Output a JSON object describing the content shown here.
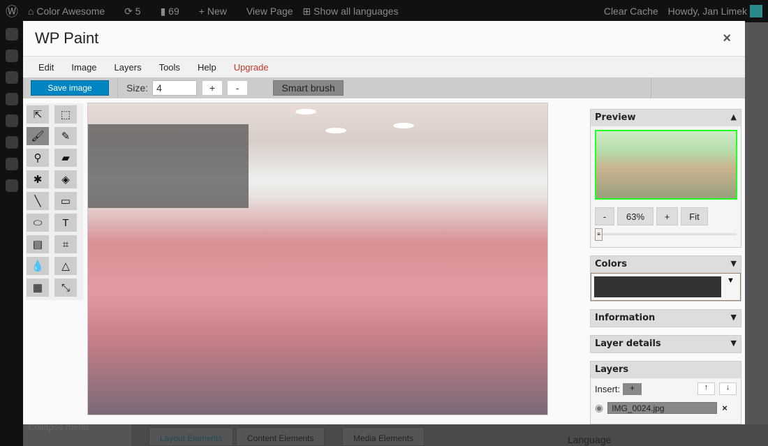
{
  "adminbar": {
    "site": "Color Awesome",
    "updates": "5",
    "comments": "69",
    "new": "New",
    "view_page": "View Page",
    "languages": "Show all languages",
    "clear_cache": "Clear Cache",
    "howdy": "Howdy, Jan Limek"
  },
  "background": {
    "collapse_menu": "Collapse menu",
    "tabs": [
      "Layout Elements",
      "Content Elements",
      "Media Elements"
    ],
    "language": "Language"
  },
  "modal": {
    "title": "WP Paint",
    "close": "×"
  },
  "menu": [
    "Edit",
    "Image",
    "Layers",
    "Tools",
    "Help",
    "Upgrade"
  ],
  "toolbar": {
    "save": "Save image",
    "size_label": "Size:",
    "size_value": "4",
    "plus": "+",
    "minus": "-",
    "smart_brush": "Smart brush"
  },
  "tools": [
    {
      "name": "select",
      "glyph": "⇱"
    },
    {
      "name": "select-rect",
      "glyph": "⬚"
    },
    {
      "name": "brush",
      "glyph": "🖌"
    },
    {
      "name": "pencil",
      "glyph": "✎"
    },
    {
      "name": "pick-color",
      "glyph": "⚲"
    },
    {
      "name": "erase",
      "glyph": "▰"
    },
    {
      "name": "magic-wand",
      "glyph": "✱"
    },
    {
      "name": "fill",
      "glyph": "◈"
    },
    {
      "name": "line",
      "glyph": "╲"
    },
    {
      "name": "rectangle",
      "glyph": "▭"
    },
    {
      "name": "ellipse",
      "glyph": "⬭"
    },
    {
      "name": "text",
      "glyph": "T"
    },
    {
      "name": "gradient",
      "glyph": "▤"
    },
    {
      "name": "crop",
      "glyph": "⌗"
    },
    {
      "name": "blur",
      "glyph": "💧"
    },
    {
      "name": "sharpen",
      "glyph": "△"
    },
    {
      "name": "clone",
      "glyph": "▦"
    },
    {
      "name": "resize",
      "glyph": "⤡"
    }
  ],
  "panel": {
    "preview": {
      "title": "Preview",
      "zoom_out": "-",
      "zoom": "63%",
      "zoom_in": "+",
      "fit": "Fit",
      "slider_value": 0
    },
    "colors": {
      "title": "Colors",
      "current": "#333333"
    },
    "information": {
      "title": "Information"
    },
    "layer_details": {
      "title": "Layer details"
    },
    "layers": {
      "title": "Layers",
      "insert_label": "Insert:",
      "insert": "+",
      "up": "↑",
      "down": "↓",
      "items": [
        {
          "name": "IMG_0024.jpg"
        }
      ],
      "delete": "×"
    }
  },
  "colors": {
    "accent": "#0085c3",
    "upgrade": "#c0392b"
  }
}
